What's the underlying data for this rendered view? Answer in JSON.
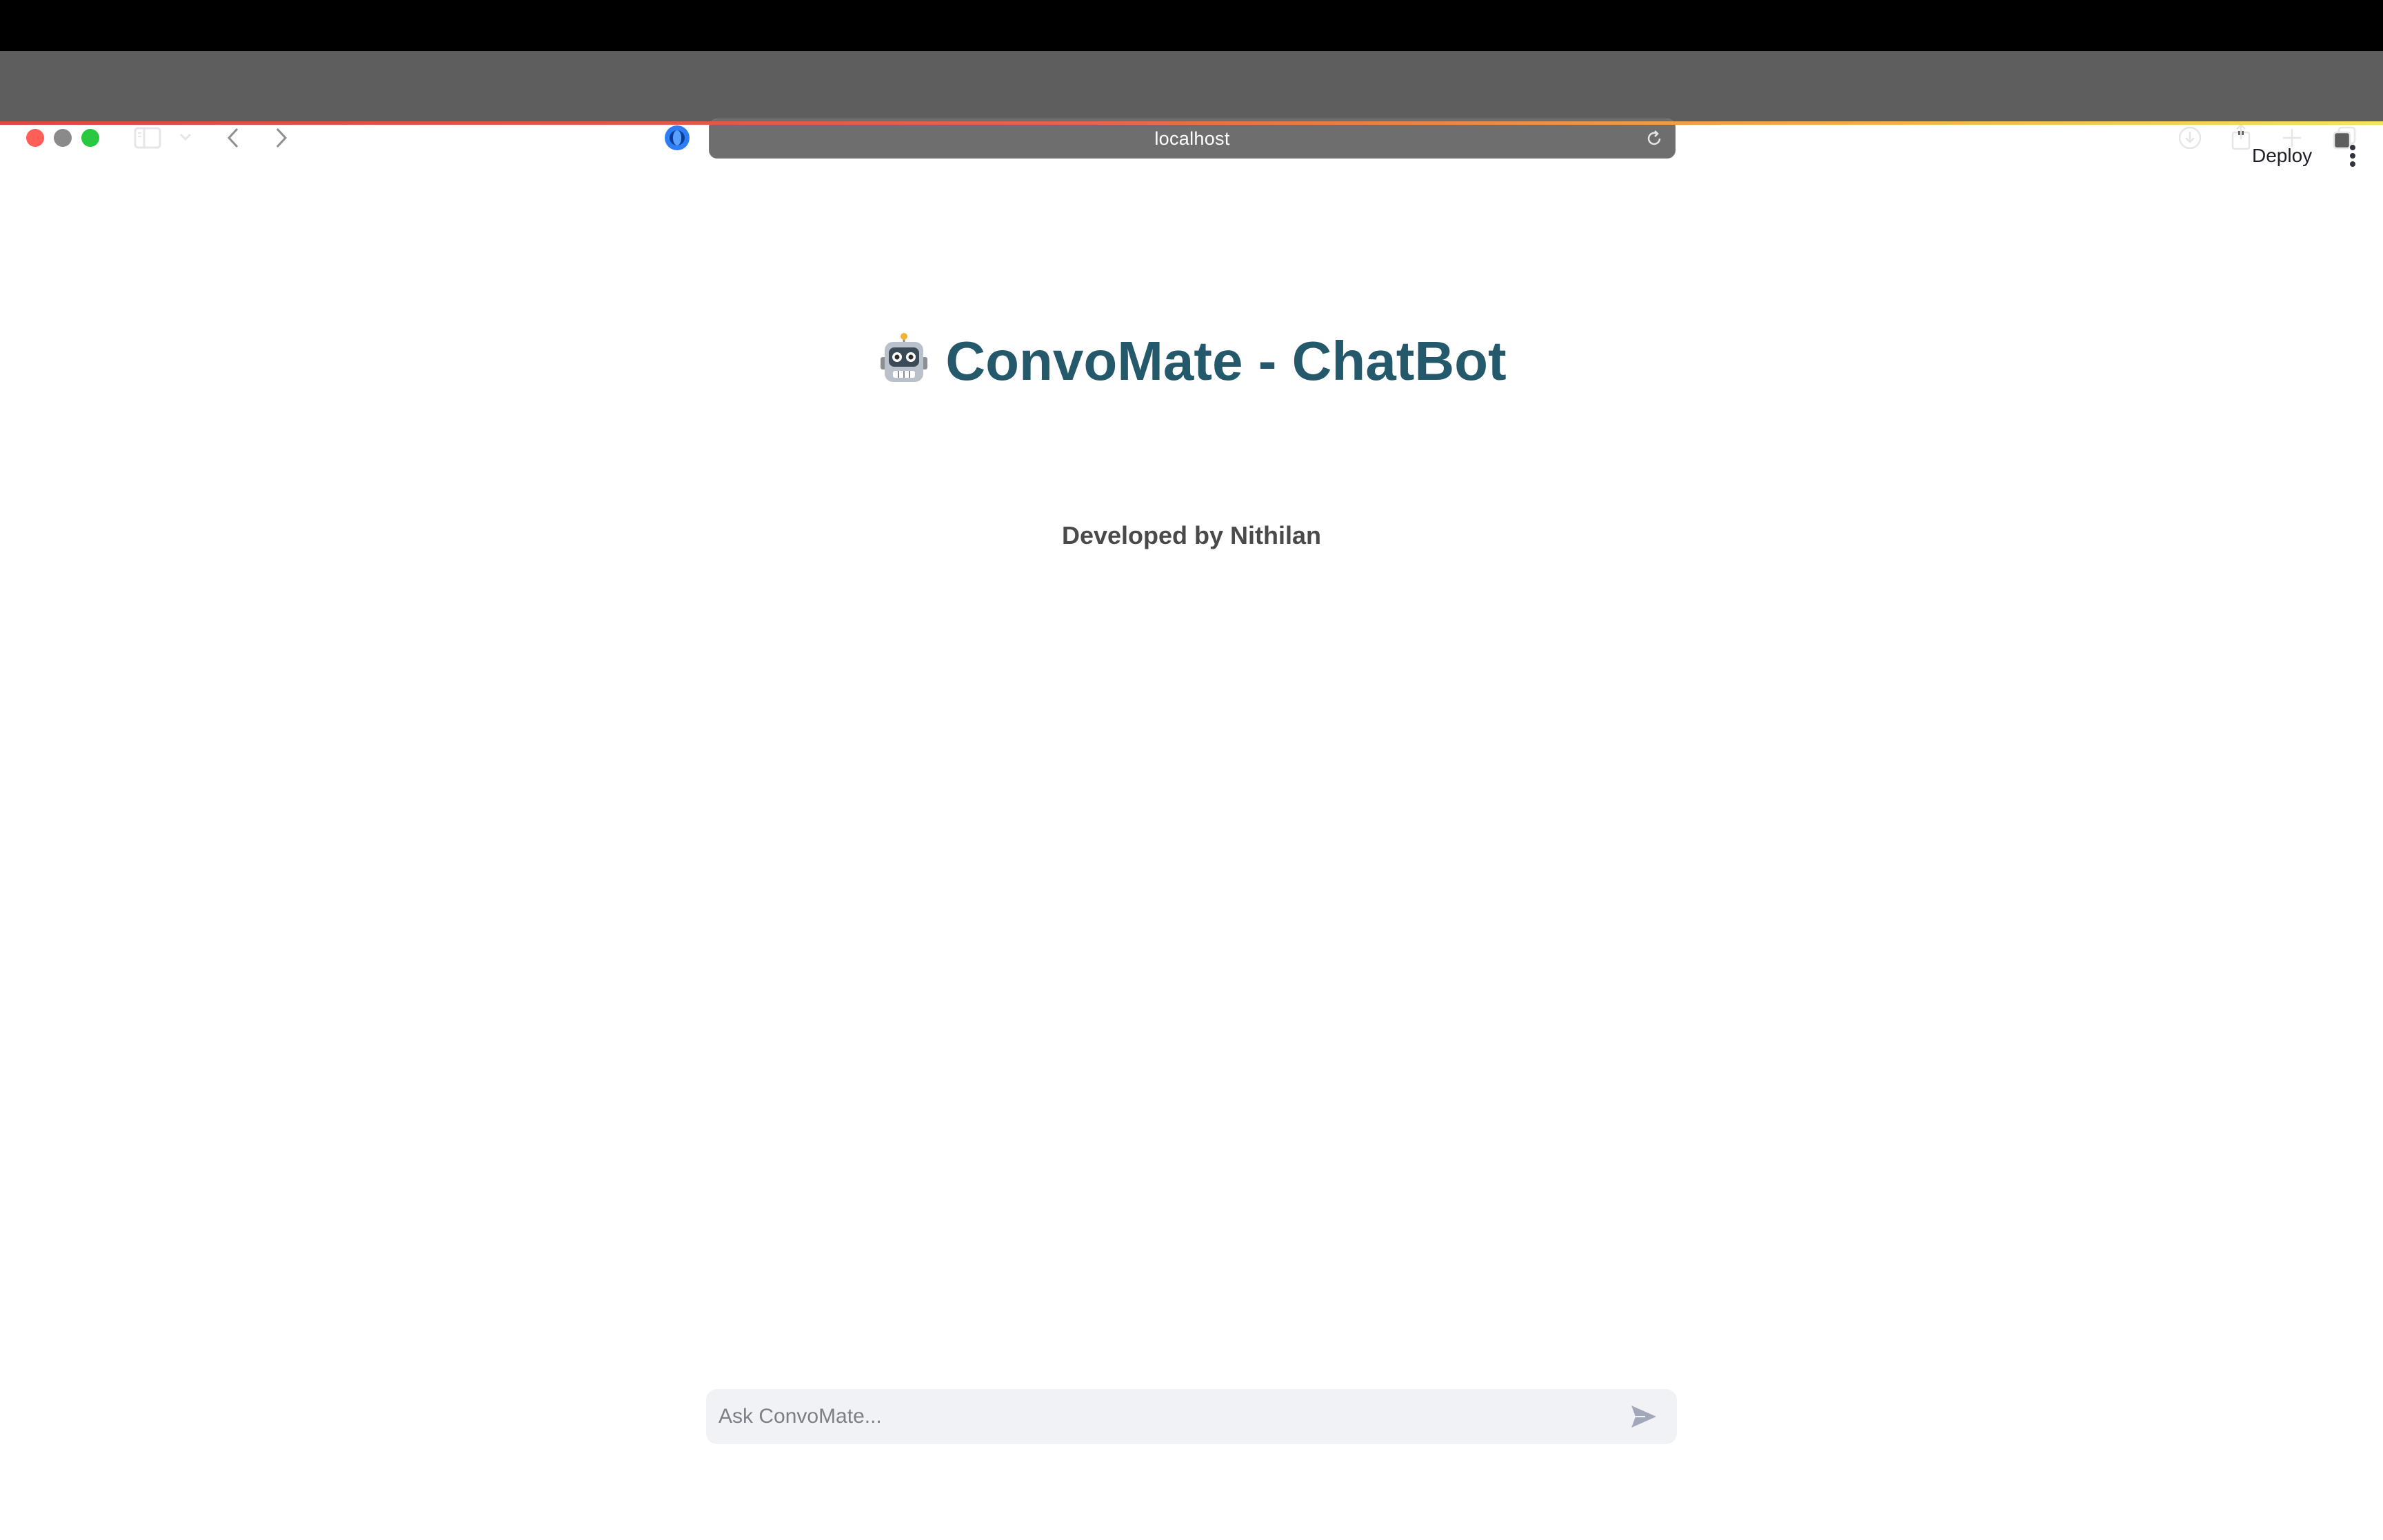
{
  "browser": {
    "url": "localhost",
    "icons": {
      "sidebar": "sidebar-toggle-icon",
      "sidebar_menu": "chevron-down-icon",
      "back": "chevron-left-icon",
      "forward": "chevron-right-icon",
      "privacy": "privacy-shield-icon",
      "reload": "reload-icon",
      "download": "download-icon",
      "share": "share-icon",
      "new_tab": "plus-icon",
      "tab_overview": "tabs-overview-icon"
    }
  },
  "app": {
    "header": {
      "deploy_label": "Deploy",
      "menu_icon": "kebab-menu-icon"
    },
    "title_emoji": "🤖",
    "title": "ConvoMate - ChatBot",
    "subtitle": "Developed by Nithilan",
    "chat": {
      "placeholder": "Ask ConvoMate...",
      "value": "",
      "send_icon": "send-icon"
    }
  },
  "colors": {
    "title": "#23596b",
    "subtitle": "#4a4a4a",
    "chat_bg": "#f0f2f6",
    "toolbar": "#5e5e5e"
  }
}
